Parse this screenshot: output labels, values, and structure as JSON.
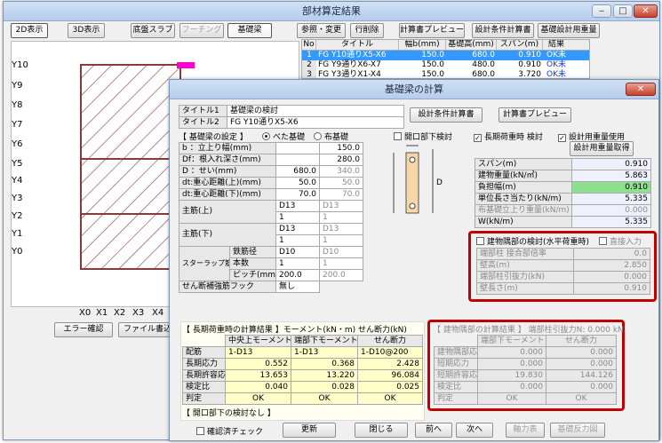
{
  "bg": {
    "title": "部材算定結果",
    "tabs": [
      "2D表示",
      "3D表示"
    ],
    "modes": [
      "底盤スラブ",
      "フーチング",
      "基礎梁"
    ],
    "toolbar": [
      "参照・変更",
      "行削除",
      "計算書プレビュー",
      "設計条件計算書",
      "基礎設計用重量"
    ],
    "table_headers": [
      "No",
      "タイトル",
      "幅b(mm)",
      "基礎高(mm)",
      "スパン(m)",
      "結果"
    ],
    "rows": [
      [
        "1",
        "FG Y10通りX5-X6",
        "150.0",
        "680.0",
        "0.910",
        "OK未"
      ],
      [
        "2",
        "FG Y9通りX6-X7",
        "150.0",
        "480.0",
        "0.910",
        "OK未"
      ],
      [
        "3",
        "FG Y3通りX1-X4",
        "150.0",
        "680.0",
        "3.720",
        "OK未"
      ]
    ],
    "y_axis": [
      "Y10",
      "Y9",
      "Y8",
      "Y7",
      "Y6",
      "Y5",
      "Y4",
      "Y3",
      "Y2",
      "Y1",
      "Y0"
    ],
    "x_axis": [
      "X0",
      "X1",
      "X2",
      "X3",
      "X4"
    ],
    "bottom": [
      "エラー確認",
      "ファイル書込"
    ]
  },
  "fg": {
    "title": "基礎梁の計算",
    "title1_label": "タイトル1",
    "title1_value": "基礎梁の検討",
    "title2_label": "タイトル2",
    "title2_value": "FG Y10通りX5-X6",
    "btn_design_calc": "設計条件計算書",
    "btn_preview": "計算書プレビュー",
    "settings_head": "【 基礎梁の設定 】",
    "radio1": "べた基礎",
    "radio2": "布基礎",
    "settings": [
      {
        "label": "b ：立上り幅(mm)",
        "v1": "",
        "v2": "150.0"
      },
      {
        "label": "Df：根入れ深さ(mm)",
        "v1": "",
        "v2": "280.0"
      },
      {
        "label": "D ：せい(mm)",
        "v1": "680.0",
        "v2": "340.0"
      },
      {
        "label": "dt:重心距離(上)(mm)",
        "v1": "50.0",
        "v2": "50.0"
      },
      {
        "label": "dt:重心距離(下)(mm)",
        "v1": "70.0",
        "v2": "70.0"
      }
    ],
    "rebar_upper": {
      "label": "主筋(上)",
      "a1": "D13",
      "a2": "D13",
      "b1": "1",
      "b2": "1"
    },
    "rebar_lower": {
      "label": "主筋(下)",
      "a1": "D13",
      "a2": "D13",
      "b1": "1",
      "b2": "1"
    },
    "stirrup": {
      "label": "スターラップ筋",
      "r1": "鉄筋径",
      "r1a": "D10",
      "r1b": "D10",
      "r2": "本数",
      "r2a": "1",
      "r2b": "1",
      "r3": "ピッチ(mm)",
      "r3a": "200.0",
      "r3b": "200.0"
    },
    "shear_hook": {
      "label": "せん断補強筋フック",
      "value": "無し"
    },
    "opening_check": "開口部下検討",
    "chk_long": "長期荷重時 検討",
    "chk_weight": "設計用重量使用",
    "btn_weight": "設計用重量取得",
    "right_table": [
      {
        "label": "スパン(m)",
        "value": "0.910",
        "cls": "bl"
      },
      {
        "label": "建物重量(kN/㎡)",
        "value": "5.863",
        "cls": "bl"
      },
      {
        "label": "負担幅(m)",
        "value": "0.910",
        "cls": "gr"
      },
      {
        "label": "単位長さ当たり(kN/m)",
        "value": "5.335",
        "cls": "bl"
      },
      {
        "label": "布基礎立上り重量(kN/m)",
        "value": "0.000",
        "cls": "bl gray"
      },
      {
        "label": "W(kN/m)",
        "value": "5.335",
        "cls": "bl"
      }
    ],
    "corner_check": "建物隅部の検討(水平荷重時)",
    "direct_input": "直接入力",
    "corner_table": [
      {
        "label": "端部柱 接合部倍率",
        "value": "0.0"
      },
      {
        "label": "壁高(m)",
        "value": "2.850"
      },
      {
        "label": "端部柱引抜力(kN)",
        "value": "0.000"
      },
      {
        "label": "壁長さ(m)",
        "value": "0.910"
      }
    ],
    "long_head": "【 長期荷重時の計算結果 】モーメント(kN・m) せん断力(kN)",
    "long_cols": [
      "中央上モーメント",
      "端部下モーメント",
      "せん断力"
    ],
    "long_rows": [
      {
        "label": "配筋",
        "c": [
          "1-D13",
          "1-D13",
          "1-D10@200"
        ]
      },
      {
        "label": "長期応力",
        "c": [
          "0.552",
          "0.368",
          "2.428"
        ]
      },
      {
        "label": "長期許容応力",
        "c": [
          "13.653",
          "13.220",
          "96.084"
        ]
      },
      {
        "label": "検定比",
        "c": [
          "0.040",
          "0.028",
          "0.025"
        ]
      },
      {
        "label": "判定",
        "c": [
          "OK",
          "OK",
          "OK"
        ]
      }
    ],
    "opening_head": "【 開口部下の検討なし 】",
    "corner_head": "【 建物隅部の計算結果 】 端部柱引抜力N: 0.000 kN",
    "corner_cols": [
      "端部下モーメント",
      "せん断力"
    ],
    "corner_rows": [
      {
        "label": "建物隅部応力",
        "c": [
          "0.000",
          "0.000"
        ]
      },
      {
        "label": "短期応力",
        "c": [
          "0.000",
          "0.000"
        ]
      },
      {
        "label": "短期許容応力",
        "c": [
          "19.830",
          "144.126"
        ]
      },
      {
        "label": "検定比",
        "c": [
          "0.000",
          "0.000"
        ]
      },
      {
        "label": "判定",
        "c": [
          "OK",
          "OK"
        ]
      }
    ],
    "confirm_check": "確認済チェック",
    "buttons": [
      "更新",
      "閉じる",
      "前へ",
      "次へ",
      "軸力表",
      "基礎反力図"
    ],
    "diagram_label": "D"
  }
}
